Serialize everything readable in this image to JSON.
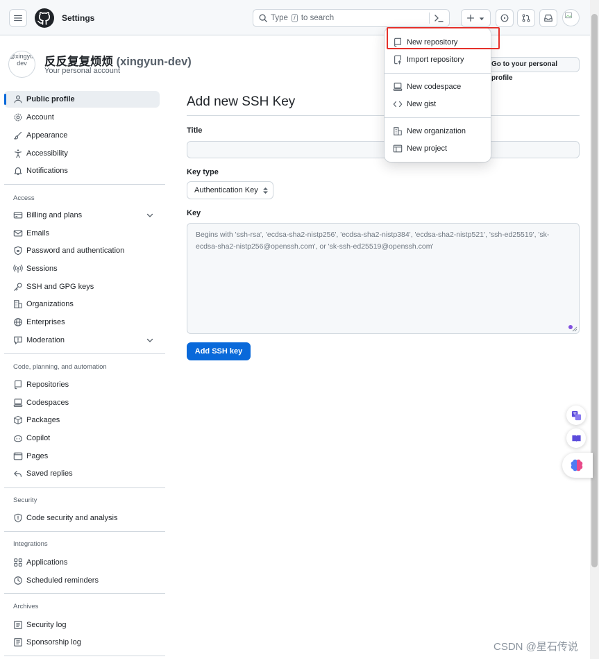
{
  "header": {
    "context_label": "Settings",
    "search_prefix": "Type",
    "search_key": "/",
    "search_suffix": "to search"
  },
  "profile": {
    "avatar_alt": "@xingyun-dev",
    "display_name": "反反复复烦烦",
    "login": "(xingyun-dev)",
    "subtitle": "Your personal account",
    "profile_button": "Go to your personal profile"
  },
  "sidebar": {
    "top_items": [
      {
        "label": "Public profile",
        "icon": "person-icon"
      },
      {
        "label": "Account",
        "icon": "gear-icon"
      },
      {
        "label": "Appearance",
        "icon": "paintbrush-icon"
      },
      {
        "label": "Accessibility",
        "icon": "accessibility-icon"
      },
      {
        "label": "Notifications",
        "icon": "bell-icon"
      }
    ],
    "groups": {
      "access": "Access",
      "code": "Code, planning, and automation",
      "security": "Security",
      "integrations": "Integrations",
      "archives": "Archives"
    },
    "access_items": [
      {
        "label": "Billing and plans",
        "icon": "credit-card-icon"
      },
      {
        "label": "Emails",
        "icon": "mail-icon"
      },
      {
        "label": "Password and authentication",
        "icon": "shield-lock-icon"
      },
      {
        "label": "Sessions",
        "icon": "broadcast-icon"
      },
      {
        "label": "SSH and GPG keys",
        "icon": "key-icon"
      },
      {
        "label": "Organizations",
        "icon": "organization-icon"
      },
      {
        "label": "Enterprises",
        "icon": "globe-icon"
      },
      {
        "label": "Moderation",
        "icon": "report-icon"
      }
    ],
    "code_items": [
      {
        "label": "Repositories",
        "icon": "repo-icon"
      },
      {
        "label": "Codespaces",
        "icon": "codespaces-icon"
      },
      {
        "label": "Packages",
        "icon": "package-icon"
      },
      {
        "label": "Copilot",
        "icon": "copilot-icon"
      },
      {
        "label": "Pages",
        "icon": "browser-icon"
      },
      {
        "label": "Saved replies",
        "icon": "reply-icon"
      }
    ],
    "security_items": [
      {
        "label": "Code security and analysis",
        "icon": "shield-icon"
      }
    ],
    "integration_items": [
      {
        "label": "Applications",
        "icon": "apps-icon"
      },
      {
        "label": "Scheduled reminders",
        "icon": "clock-icon"
      }
    ],
    "archive_items": [
      {
        "label": "Security log",
        "icon": "log-icon"
      },
      {
        "label": "Sponsorship log",
        "icon": "log-icon"
      }
    ]
  },
  "main": {
    "title": "Add new SSH Key",
    "title_label": "Title",
    "key_type_label": "Key type",
    "key_type_value": "Authentication Key",
    "key_label": "Key",
    "key_placeholder": "Begins with 'ssh-rsa', 'ecdsa-sha2-nistp256', 'ecdsa-sha2-nistp384', 'ecdsa-sha2-nistp521', 'ssh-ed25519', 'sk-ecdsa-sha2-nistp256@openssh.com', or 'sk-ssh-ed25519@openssh.com'",
    "submit_label": "Add SSH key"
  },
  "create_menu": {
    "items": [
      {
        "label": "New repository",
        "icon": "repo-icon"
      },
      {
        "label": "Import repository",
        "icon": "repo-push-icon"
      },
      {
        "label": "New codespace",
        "icon": "codespaces-icon"
      },
      {
        "label": "New gist",
        "icon": "code-icon"
      },
      {
        "label": "New organization",
        "icon": "organization-icon"
      },
      {
        "label": "New project",
        "icon": "table-icon"
      }
    ]
  },
  "watermark": "CSDN @星石传说",
  "colors": {
    "accent": "#0969da",
    "highlight_border": "#e5302a",
    "header_bg": "#f6f8fa"
  }
}
